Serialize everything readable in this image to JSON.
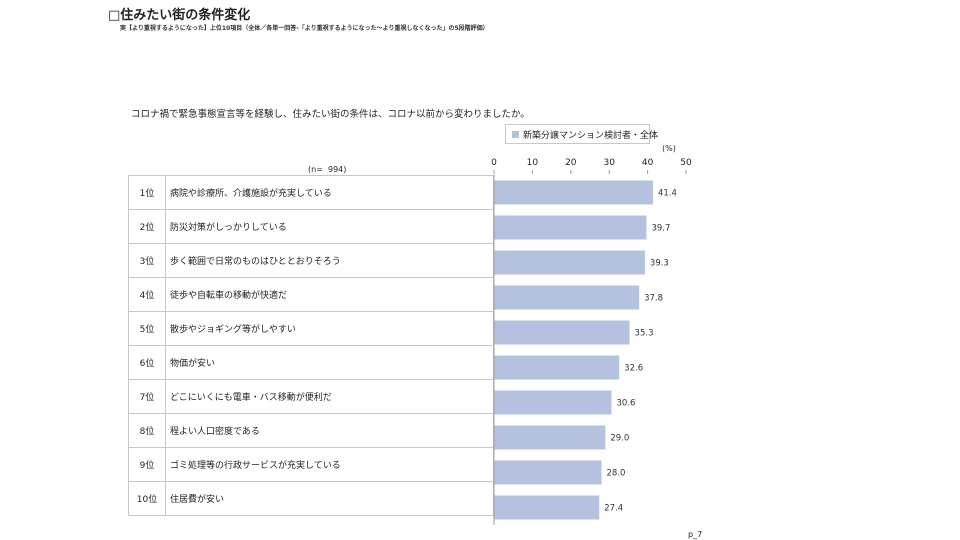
{
  "header": {
    "title": "□住みたい街の条件変化",
    "subtitle": "実【より重視するようになった】上位10項目（全体／各単一回答-「より重視するようになった～より重視しなくなった」の5段階評価）"
  },
  "question": "コロナ禍で緊急事態宣言等を経験し、住みたい街の条件は、コロナ以前から変わりましたか。",
  "legend": {
    "label": "新築分譲マンション検討者・全体",
    "color": "#b4c2e0"
  },
  "unit_label": "(%)",
  "n_label": "(n=  994)",
  "page_number": "p_7",
  "chart_data": {
    "type": "bar",
    "orientation": "horizontal",
    "xlim": [
      0,
      50
    ],
    "x_ticks": [
      0,
      10,
      20,
      30,
      40,
      50
    ],
    "bar_color": "#b4c2e0",
    "series": [
      {
        "name": "新築分譲マンション検討者・全体"
      }
    ],
    "rows": [
      {
        "rank": "1位",
        "label": "病院や診療所、介護施設が充実している",
        "value": 41.4,
        "value_label": "41.4"
      },
      {
        "rank": "2位",
        "label": "防災対策がしっかりしている",
        "value": 39.7,
        "value_label": "39.7"
      },
      {
        "rank": "3位",
        "label": "歩く範囲で日常のものはひととおりそろう",
        "value": 39.3,
        "value_label": "39.3"
      },
      {
        "rank": "4位",
        "label": "徒歩や自転車の移動が快適だ",
        "value": 37.8,
        "value_label": "37.8"
      },
      {
        "rank": "5位",
        "label": "散歩やジョギング等がしやすい",
        "value": 35.3,
        "value_label": "35.3"
      },
      {
        "rank": "6位",
        "label": "物価が安い",
        "value": 32.6,
        "value_label": "32.6"
      },
      {
        "rank": "7位",
        "label": "どこにいくにも電車・バス移動が便利だ",
        "value": 30.6,
        "value_label": "30.6"
      },
      {
        "rank": "8位",
        "label": "程よい人口密度である",
        "value": 29.0,
        "value_label": "29.0"
      },
      {
        "rank": "9位",
        "label": "ゴミ処理等の行政サービスが充実している",
        "value": 28.0,
        "value_label": "28.0"
      },
      {
        "rank": "10位",
        "label": "住居費が安い",
        "value": 27.4,
        "value_label": "27.4"
      }
    ]
  }
}
